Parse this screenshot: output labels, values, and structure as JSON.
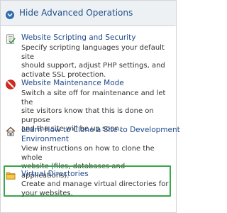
{
  "header": {
    "title": "Hide Advanced Operations"
  },
  "items": [
    {
      "title": "Website Scripting and Security",
      "desc_lines": [
        "Specify scripting languages your default site",
        "should support, adjust PHP settings, and",
        "activate SSL protection."
      ],
      "icon": "scripting-checklist-icon"
    },
    {
      "title": "Website Maintenance Mode",
      "desc_lines": [
        "Switch a site off for maintenance and let the",
        "site visitors know that this is done on purpose",
        "and the site will be up soon."
      ],
      "icon": "maintenance-no-entry-icon"
    },
    {
      "title_lines": [
        "Learn How to Clone a Site to Development",
        "Environment"
      ],
      "desc_lines": [
        "View instructions on how to clone the whole",
        "website (files, databases and applications)."
      ],
      "icon": "clone-house-icon"
    },
    {
      "title": "Virtual Directories",
      "desc_lines": [
        "Create and manage virtual directories for",
        "your websites."
      ],
      "icon": "folder-icon"
    }
  ],
  "colors": {
    "header_bg": "#eef1f4",
    "link": "#1e4a8c",
    "highlight_border": "#3aa64a"
  }
}
